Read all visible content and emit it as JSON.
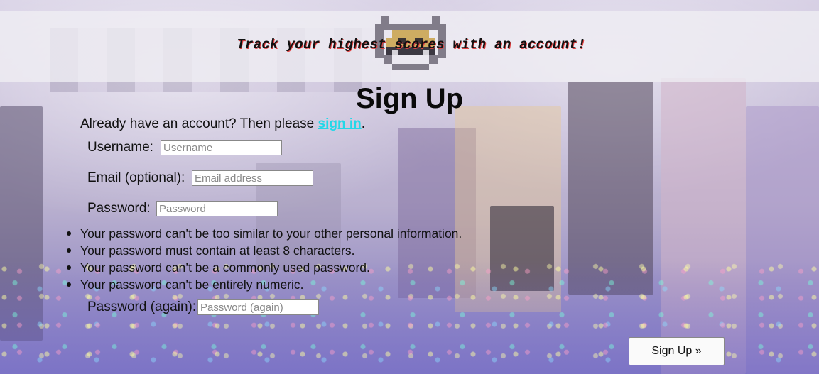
{
  "header": {
    "tagline": "Track your highest scores with an account!",
    "logo_icon": "space-invader-icon"
  },
  "form": {
    "title": "Sign Up",
    "signin_prompt": "Already have an account? Then please ",
    "signin_link": "sign in",
    "signin_suffix": ".",
    "username": {
      "label": "Username:",
      "placeholder": "Username",
      "value": ""
    },
    "email": {
      "label": "Email (optional):",
      "placeholder": "Email address",
      "value": ""
    },
    "password": {
      "label": "Password:",
      "placeholder": "Password",
      "value": ""
    },
    "password_rules": [
      "Your password can’t be too similar to your other personal information.",
      "Your password must contain at least 8 characters.",
      "Your password can’t be a commonly used password.",
      "Your password can’t be entirely numeric."
    ],
    "password_again": {
      "label": "Password (again):",
      "placeholder": "Password (again)",
      "value": ""
    },
    "submit_label": "Sign Up »"
  },
  "colors": {
    "link": "#22d8e8",
    "tagline_shadow": "#e04040",
    "banner": "#f0eef4"
  }
}
